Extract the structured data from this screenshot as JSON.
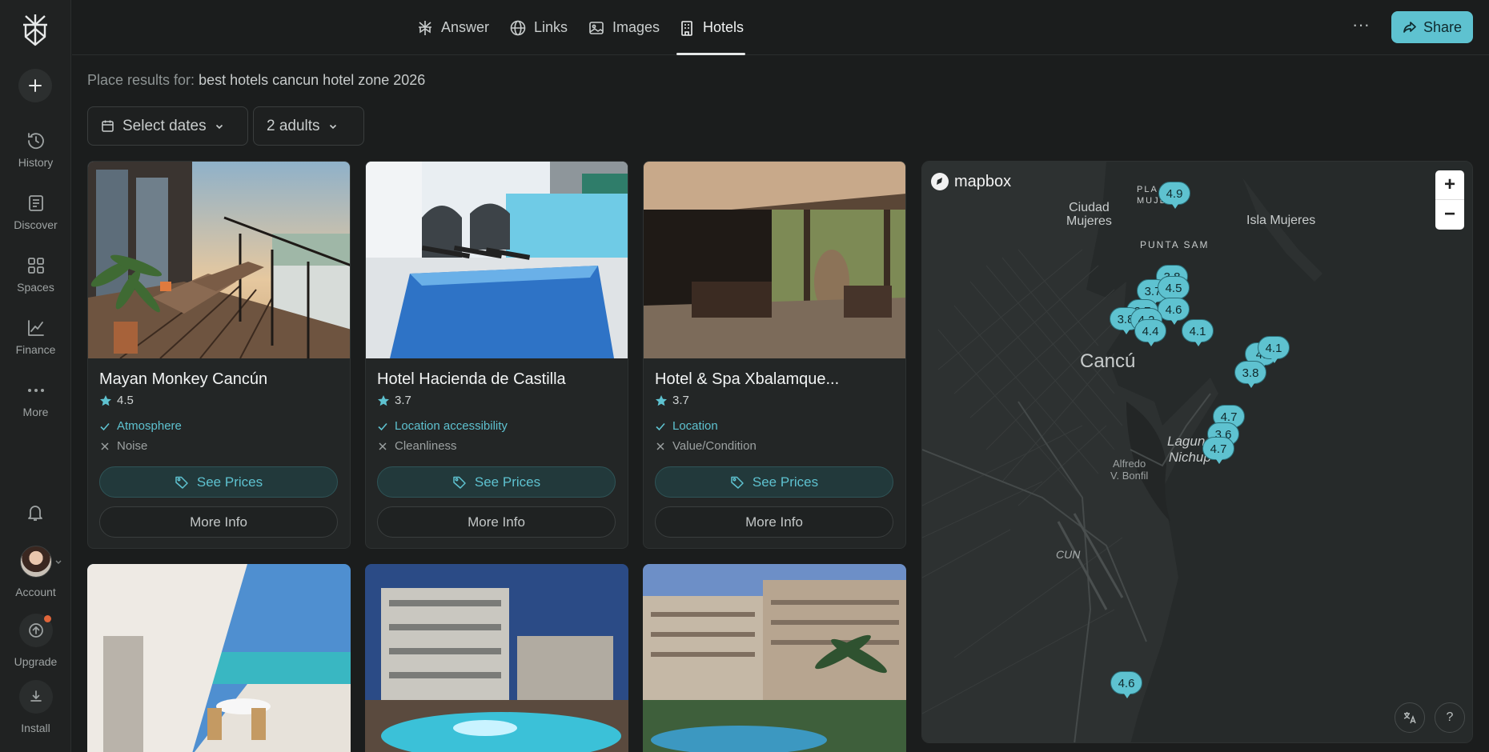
{
  "sidebar": {
    "items": [
      {
        "label": "History",
        "icon": "history-icon"
      },
      {
        "label": "Discover",
        "icon": "discover-icon"
      },
      {
        "label": "Spaces",
        "icon": "spaces-icon"
      },
      {
        "label": "Finance",
        "icon": "finance-icon"
      },
      {
        "label": "More",
        "icon": "more-icon"
      }
    ],
    "account_label": "Account",
    "upgrade_label": "Upgrade",
    "install_label": "Install"
  },
  "topbar": {
    "tabs": [
      {
        "label": "Answer"
      },
      {
        "label": "Links"
      },
      {
        "label": "Images"
      },
      {
        "label": "Hotels"
      }
    ],
    "active_tab": "Hotels",
    "more_label": "···",
    "share_label": "Share",
    "accent": "#5ec2d0"
  },
  "search": {
    "prefix": "Place results for:",
    "query": "best hotels cancun hotel zone 2026",
    "dates_label": "Select dates",
    "guests_label": "2 adults"
  },
  "hotels": [
    {
      "name": "Mayan Monkey Cancún",
      "rating": "4.5",
      "pro": "Atmosphere",
      "con": "Noise",
      "prices_label": "See Prices",
      "info_label": "More Info"
    },
    {
      "name": "Hotel Hacienda de Castilla",
      "rating": "3.7",
      "pro": "Location accessibility",
      "con": "Cleanliness",
      "prices_label": "See Prices",
      "info_label": "More Info"
    },
    {
      "name": "Hotel & Spa Xbalamque...",
      "rating": "3.7",
      "pro": "Location",
      "con": "Value/Condition",
      "prices_label": "See Prices",
      "info_label": "More Info"
    }
  ],
  "map": {
    "brand": "mapbox",
    "zoom_in": "+",
    "zoom_out": "−",
    "labels": {
      "ciudad": "Ciudad\nMujeres",
      "isla": "Isla Mujeres",
      "punta": "PUNTA SAM",
      "plm": "PLA\nMUJE",
      "cancun": "Cancú",
      "laguna": "Laguna\nNichup",
      "alfredo": "Alfredo\nV. Bonfil",
      "cun": "CUN"
    },
    "pins": [
      "4.9",
      "3.8",
      "3.7",
      "4.5",
      "3.7",
      "4.6",
      "3.8",
      "4.2",
      "4.4",
      "4.1",
      "4.",
      "4.1",
      "3.8",
      "4.7",
      "3.6",
      "4.7",
      "4.6"
    ],
    "translate_icon": "translate-icon",
    "help_label": "?"
  }
}
